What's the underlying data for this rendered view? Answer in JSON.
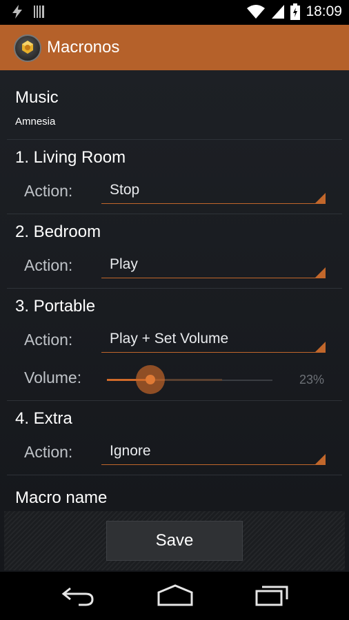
{
  "status": {
    "time": "18:09",
    "icons": [
      "flash-icon",
      "barcode-icon",
      "wifi-icon",
      "signal-icon",
      "battery-icon"
    ]
  },
  "action_bar": {
    "title": "Macronos",
    "color": "#b5612a"
  },
  "music": {
    "label": "Music",
    "value": "Amnesia"
  },
  "rooms": [
    {
      "title": "1. Living Room",
      "action_label": "Action:",
      "action": "Stop"
    },
    {
      "title": "2. Bedroom",
      "action_label": "Action:",
      "action": "Play"
    },
    {
      "title": "3. Portable",
      "action_label": "Action:",
      "action": "Play + Set Volume",
      "volume_label": "Volume:",
      "volume_percent": 23,
      "volume_text": "23%"
    },
    {
      "title": "4. Extra",
      "action_label": "Action:",
      "action": "Ignore"
    }
  ],
  "macro": {
    "name_label": "Macro name"
  },
  "footer": {
    "save_label": "Save"
  },
  "nav": {
    "icons": [
      "back-icon",
      "home-icon",
      "recents-icon"
    ]
  },
  "colors": {
    "accent": "#c2672b",
    "background": "#1d2025"
  }
}
